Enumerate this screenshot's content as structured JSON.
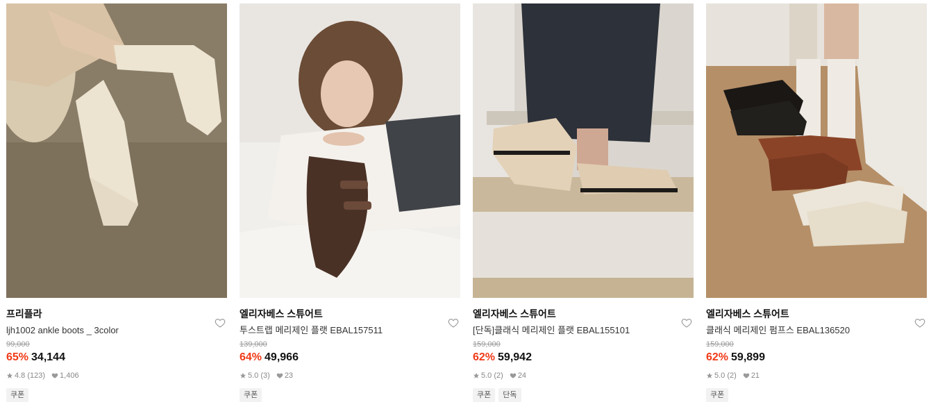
{
  "products": [
    {
      "brand": "프리플라",
      "name": "ljh1002 ankle boots _ 3color",
      "original_price": "99,000",
      "discount": "65%",
      "price": "34,144",
      "rating": "4.8",
      "reviews": "(123)",
      "likes": "1,406",
      "tags": [
        "쿠폰"
      ]
    },
    {
      "brand": "엘리자베스 스튜어트",
      "name": "투스트랩 메리제인 플랫 EBAL157511",
      "original_price": "139,000",
      "discount": "64%",
      "price": "49,966",
      "rating": "5.0",
      "reviews": "(3)",
      "likes": "23",
      "tags": [
        "쿠폰"
      ]
    },
    {
      "brand": "엘리자베스 스튜어트",
      "name": "[단독]클래식 메리제인 플랫 EBAL155101",
      "original_price": "159,000",
      "discount": "62%",
      "price": "59,942",
      "rating": "5.0",
      "reviews": "(2)",
      "likes": "24",
      "tags": [
        "쿠폰",
        "단독"
      ]
    },
    {
      "brand": "엘리자베스 스튜어트",
      "name": "클래식 메리제인 펌프스 EBAL136520",
      "original_price": "159,000",
      "discount": "62%",
      "price": "59,899",
      "rating": "5.0",
      "reviews": "(2)",
      "likes": "21",
      "tags": [
        "쿠폰"
      ]
    }
  ],
  "colors": {
    "discount": "#f03a17",
    "tag_bg": "#f2f2f2"
  },
  "icons": {
    "wishlist": "heart-outline-icon",
    "rating": "star-icon",
    "likes": "heart-filled-icon"
  }
}
